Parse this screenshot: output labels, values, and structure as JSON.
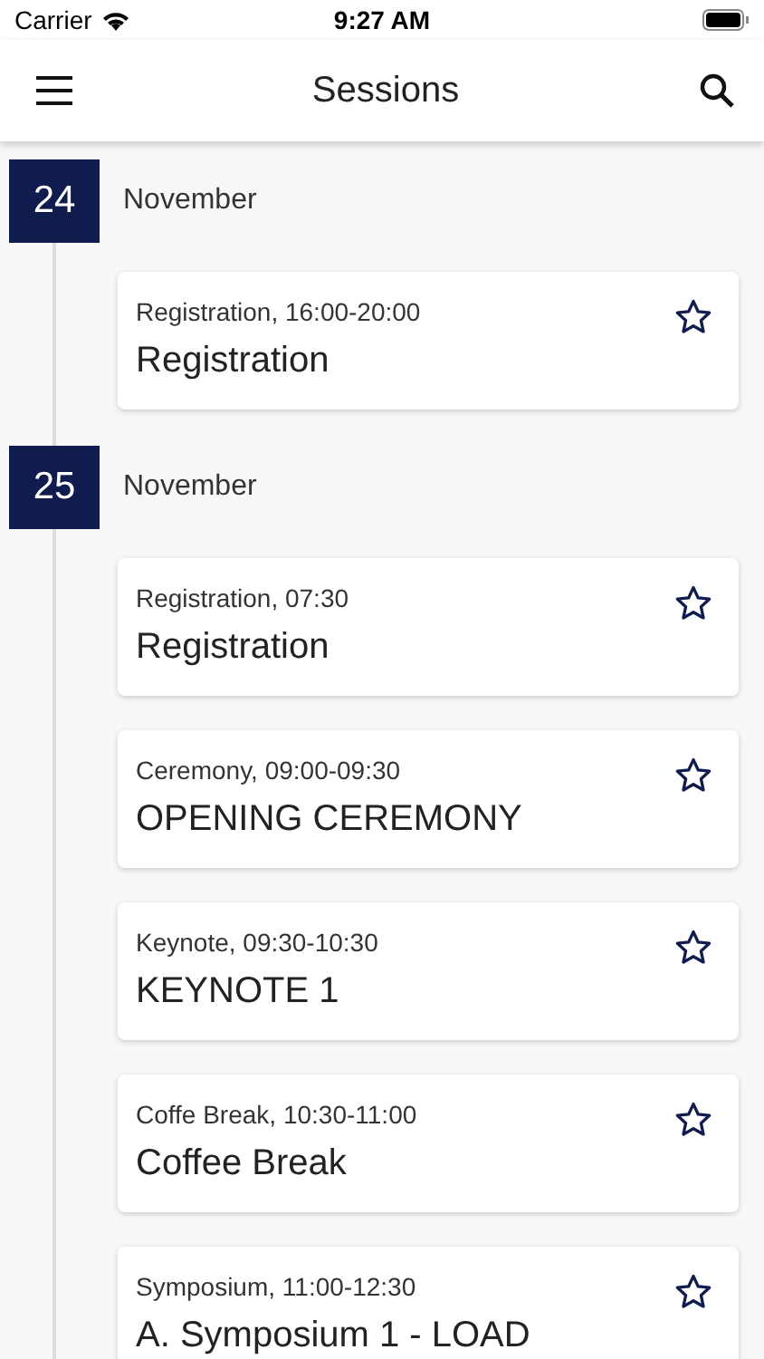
{
  "status_bar": {
    "carrier": "Carrier",
    "time": "9:27 AM"
  },
  "app_bar": {
    "title": "Sessions"
  },
  "days": [
    {
      "day": "24",
      "month": "November",
      "sessions": [
        {
          "meta": "Registration, 16:00-20:00",
          "title": "Registration",
          "starred": false
        }
      ]
    },
    {
      "day": "25",
      "month": "November",
      "sessions": [
        {
          "meta": "Registration, 07:30",
          "title": "Registration",
          "starred": false
        },
        {
          "meta": "Ceremony, 09:00-09:30",
          "title": "OPENING CEREMONY",
          "starred": false
        },
        {
          "meta": "Keynote, 09:30-10:30",
          "title": "KEYNOTE 1",
          "starred": false
        },
        {
          "meta": "Coffe Break, 10:30-11:00",
          "title": "Coffee Break",
          "starred": false
        },
        {
          "meta": "Symposium, 11:00-12:30",
          "title": "A. Symposium 1 - LOAD",
          "starred": false
        }
      ]
    }
  ]
}
